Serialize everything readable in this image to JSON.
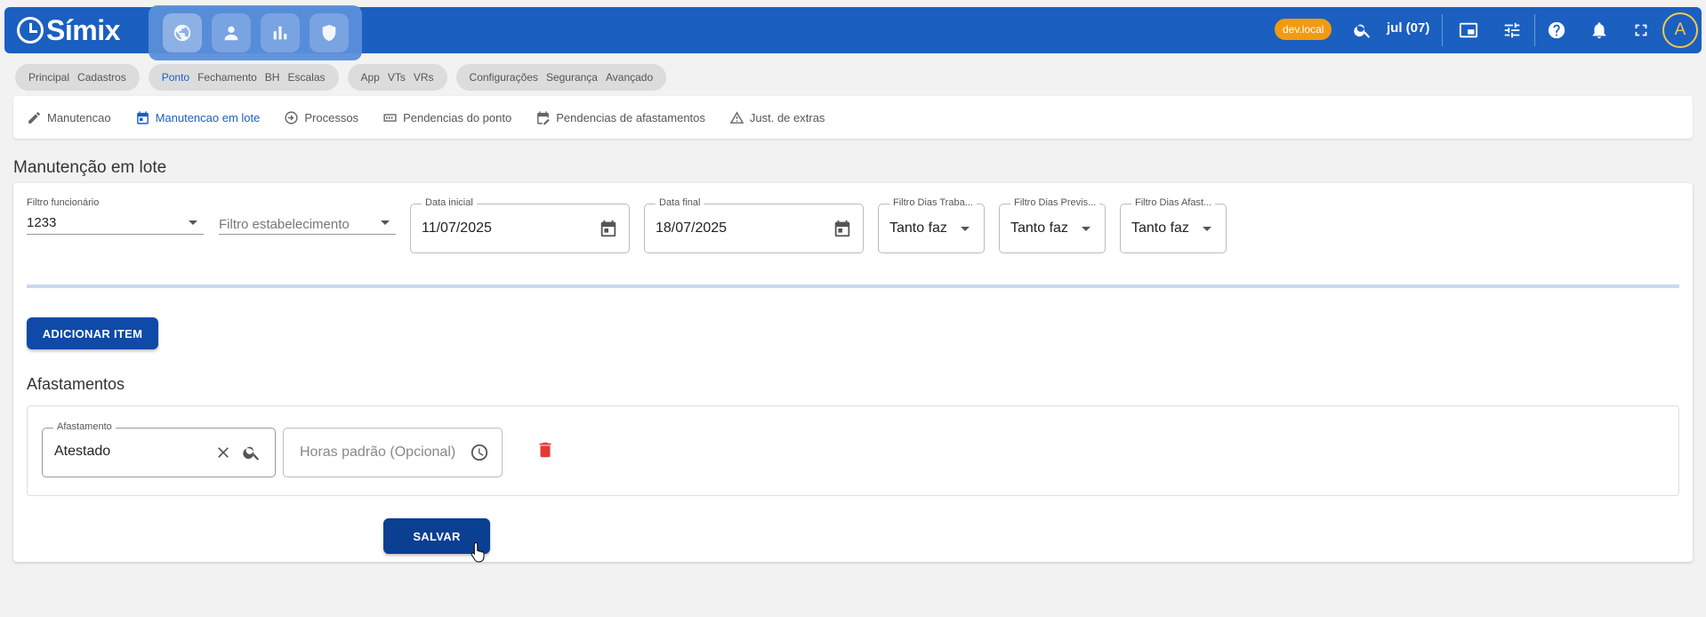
{
  "brand": {
    "name": "Símix"
  },
  "modules": [
    {
      "icon": "globe-icon"
    },
    {
      "icon": "person-icon"
    },
    {
      "icon": "bar-chart-icon"
    },
    {
      "icon": "shield-icon"
    }
  ],
  "topbar": {
    "environment": "dev.local",
    "month": "jul (07)",
    "avatar_letter": "A"
  },
  "menu_groups": [
    {
      "items": [
        "Principal",
        "Cadastros"
      ]
    },
    {
      "items": [
        "Ponto",
        "Fechamento",
        "BH",
        "Escalas"
      ],
      "active": "Ponto"
    },
    {
      "items": [
        "App",
        "VTs",
        "VRs"
      ]
    },
    {
      "items": [
        "Configurações",
        "Segurança",
        "Avançado"
      ]
    }
  ],
  "subnav": [
    {
      "label": "Manutencao",
      "icon": "pencil-icon"
    },
    {
      "label": "Manutencao em lote",
      "icon": "calendar-icon",
      "active": true
    },
    {
      "label": "Processos",
      "icon": "arrow-circle-icon"
    },
    {
      "label": "Pendencias do ponto",
      "icon": "clock-grid-icon"
    },
    {
      "label": "Pendencias de afastamentos",
      "icon": "calendar-edit-icon"
    },
    {
      "label": "Just. de extras",
      "icon": "warning-icon"
    }
  ],
  "page": {
    "title": "Manutenção em lote"
  },
  "filters": {
    "funcionario": {
      "label": "Filtro funcionário",
      "value": "1233"
    },
    "estabelecimento": {
      "placeholder": "Filtro estabelecimento"
    },
    "data_inicial": {
      "label": "Data inicial",
      "value": "11/07/2025"
    },
    "data_final": {
      "label": "Data final",
      "value": "18/07/2025"
    },
    "dias_trabalhados": {
      "label": "Filtro Dias Traba...",
      "value": "Tanto faz"
    },
    "dias_previstos": {
      "label": "Filtro Dias Previs...",
      "value": "Tanto faz"
    },
    "dias_afastados": {
      "label": "Filtro Dias Afast...",
      "value": "Tanto faz"
    }
  },
  "actions": {
    "add_item": "ADICIONAR ITEM",
    "save": "SALVAR"
  },
  "afastamentos": {
    "title": "Afastamentos",
    "afastamento": {
      "label": "Afastamento",
      "value": "Atestado"
    },
    "horas": {
      "placeholder": "Horas padrão (Opcional)"
    }
  },
  "colors": {
    "primary": "#1b5fc1",
    "env_badge": "#f29b11",
    "delete": "#e53935"
  }
}
